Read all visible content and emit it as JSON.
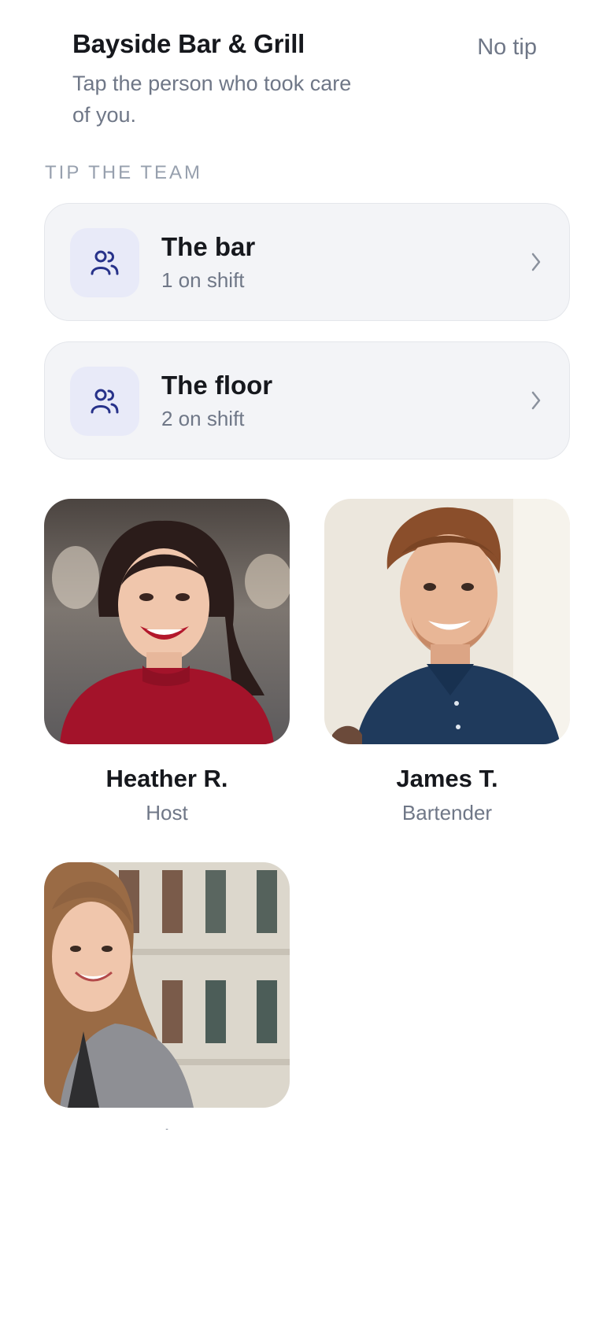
{
  "header": {
    "venue_name": "Bayside Bar & Grill",
    "subtitle": "Tap the person who took care of you.",
    "no_tip_label": "No tip"
  },
  "section": {
    "label": "TIP THE TEAM"
  },
  "teams": [
    {
      "title": "The bar",
      "subtitle": "1 on shift",
      "icon": "people-icon"
    },
    {
      "title": "The floor",
      "subtitle": "2 on shift",
      "icon": "people-icon"
    }
  ],
  "staff": [
    {
      "name": "Heather R.",
      "role": "Host"
    },
    {
      "name": "James T.",
      "role": "Bartender"
    },
    {
      "name": "-",
      "role": ""
    }
  ],
  "colors": {
    "accent": "#27328a",
    "card_bg": "#f3f4f7",
    "icon_bg": "#e8eaf8",
    "muted_text": "#6f7787"
  }
}
